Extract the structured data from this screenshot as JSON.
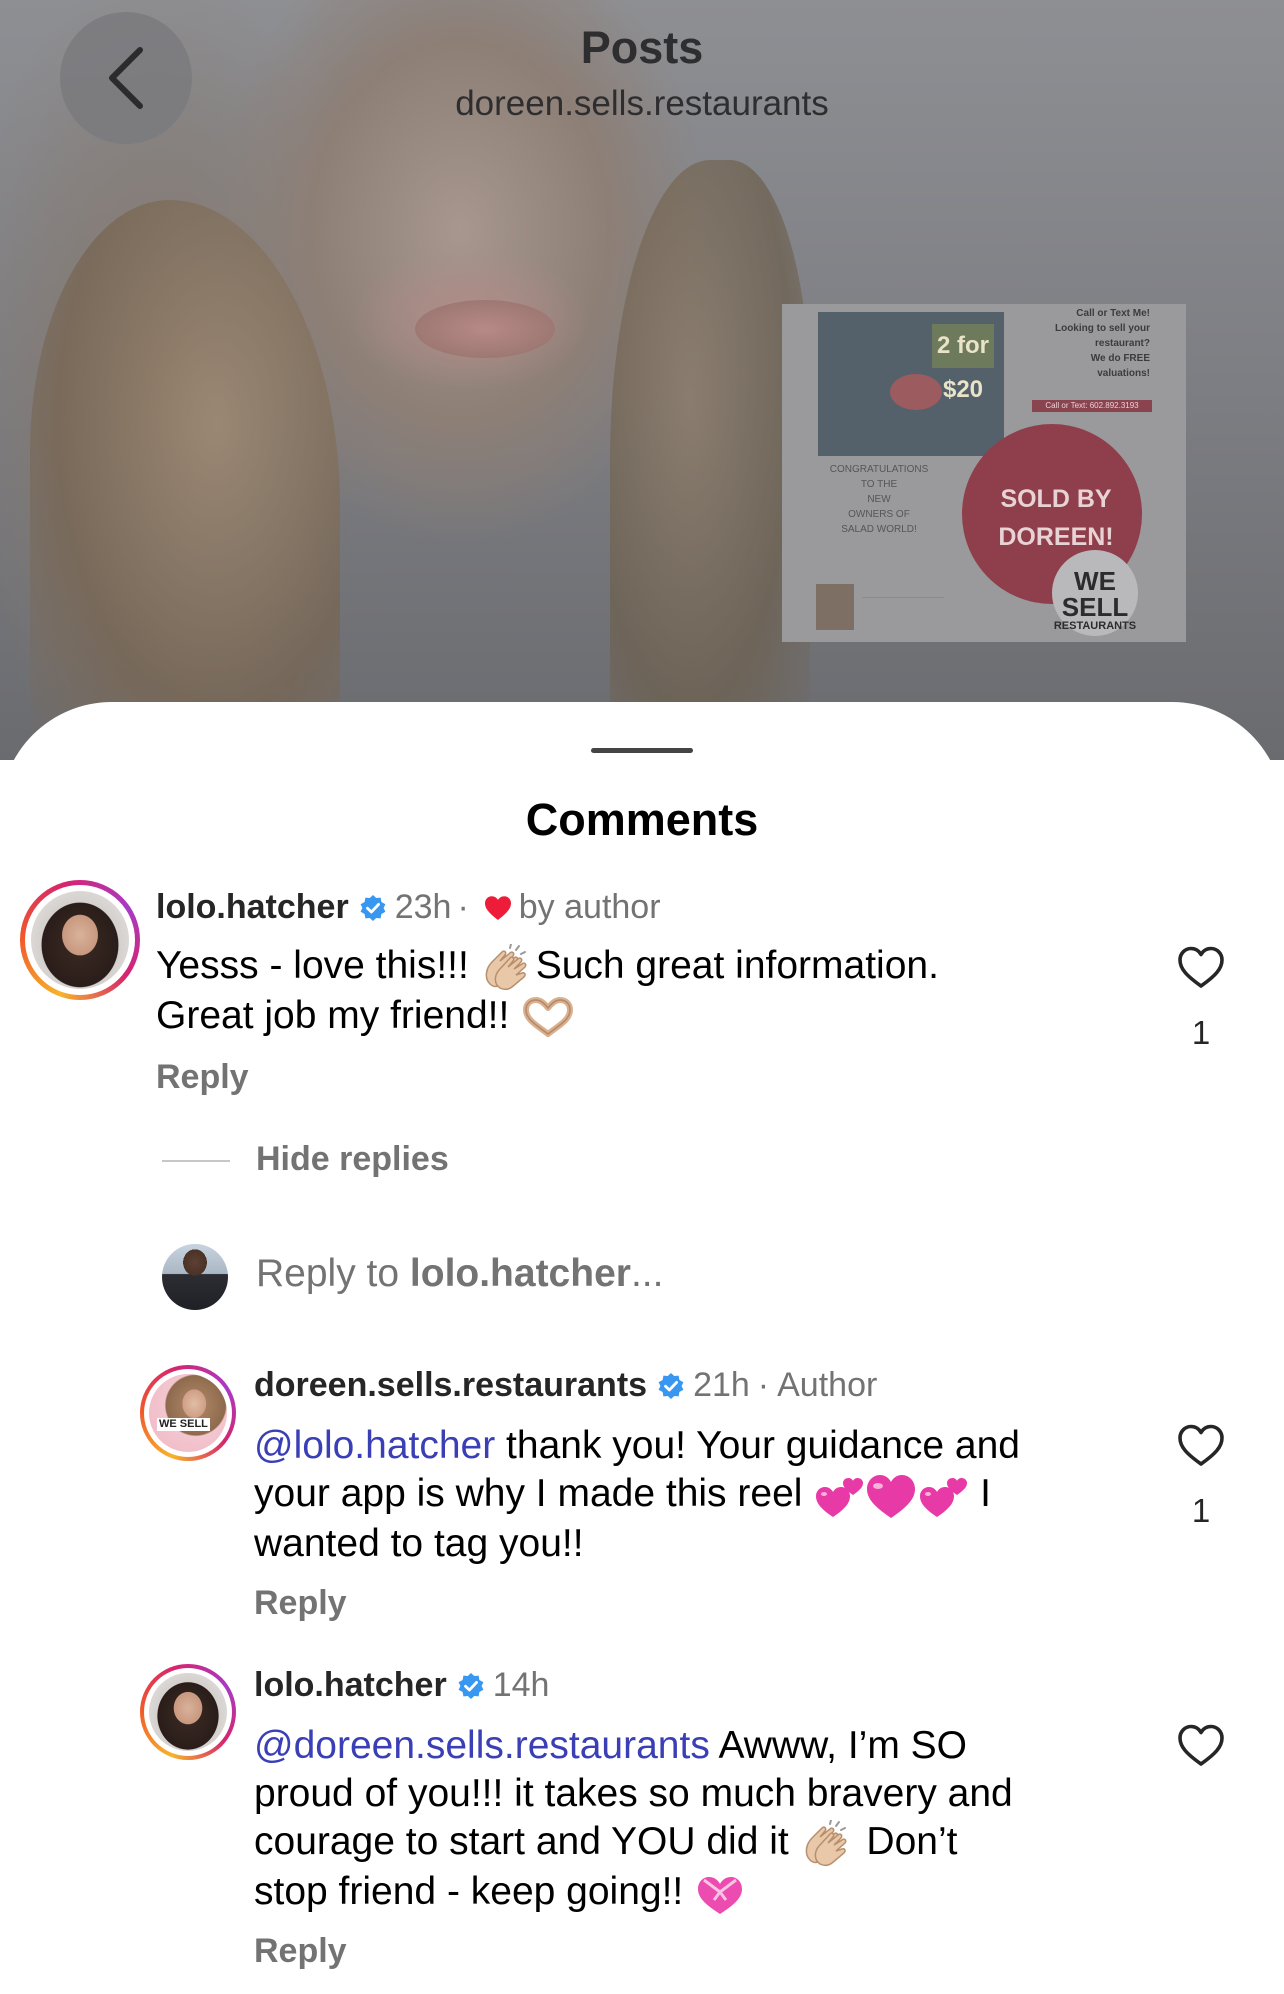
{
  "header": {
    "title": "Posts",
    "subtitle": "doreen.sells.restaurants"
  },
  "post": {
    "card_text_lines": [
      "Call or Text Me!",
      "Looking to sell your",
      "restaurant?",
      "We do FREE",
      "valuations!"
    ],
    "call_bar": "Call or Text: 602.892.3193",
    "sign": "2 for $20",
    "congrats_lines": [
      "CONGRATULATIONS",
      "TO THE",
      "NEW",
      "OWNERS OF",
      "SALAD WORLD!"
    ],
    "sold_lines": [
      "SOLD BY",
      "DOREEN!"
    ],
    "logo_big": "WE SELL",
    "logo_small": "RESTAURANTS"
  },
  "sheet": {
    "title": "Comments",
    "hide_replies": "Hide replies",
    "reply_prefix": "Reply to ",
    "reply_target": "lolo.hatcher",
    "reply_suffix": "..."
  },
  "comments": [
    {
      "username": "lolo.hatcher",
      "time": "23h",
      "separator": "·",
      "tag": "by author",
      "text_parts": [
        "Yesss - love this!!! ",
        "Such great information.",
        "Great job my friend!! "
      ],
      "reply": "Reply",
      "likes": "1"
    },
    {
      "username": "doreen.sells.restaurants",
      "time": "21h",
      "separator": "·",
      "tag": "Author",
      "mention": "@lolo.hatcher",
      "text_line1": " thank you! Your guidance and",
      "text_line2": "your app is why I made this reel ",
      "text_line2_end": " I",
      "text_line3": "wanted to tag you!!",
      "reply": "Reply",
      "likes": "1"
    },
    {
      "username": "lolo.hatcher",
      "time": "14h",
      "mention": "@doreen.sells.restaurants",
      "text_line1": " Awww, I’m SO",
      "text_line2": "proud of you!!! it takes so much bravery and",
      "text_line3": "courage to start and YOU did it ",
      "text_line3_end": " Don’t",
      "text_line4": "stop friend - keep going!! ",
      "reply": "Reply"
    }
  ],
  "colors": {
    "mention": "#3b3fb6",
    "verified": "#3897f0",
    "heart_red": "#ed1d3a",
    "muted_text": "#737373"
  },
  "icons": [
    "back-chevron-icon",
    "verified-badge-icon",
    "red-heart-icon",
    "like-heart-icon",
    "clapping-hands-emoji",
    "heart-hands-emoji",
    "two-hearts-emoji",
    "pink-heart-emoji",
    "heart-with-ribbon-emoji"
  ]
}
